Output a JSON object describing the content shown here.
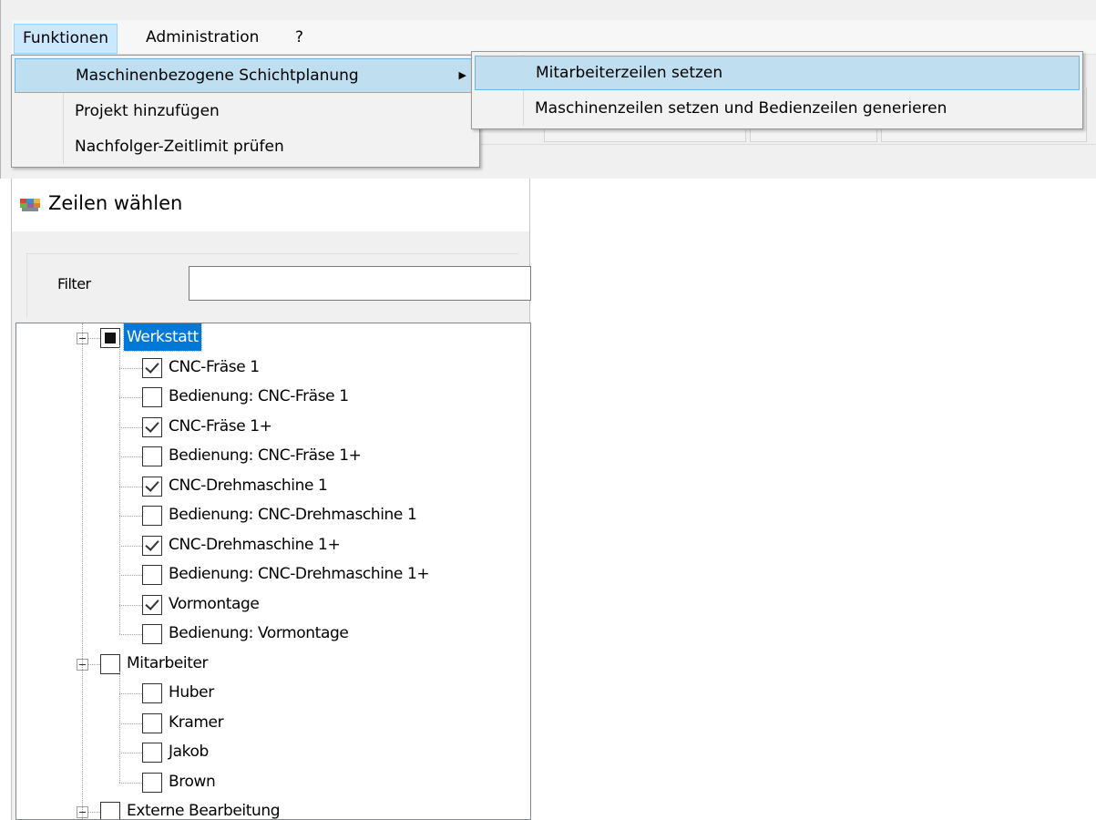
{
  "menubar": {
    "items": [
      {
        "label": "Funktionen"
      },
      {
        "label": "Administration"
      },
      {
        "label": "?"
      }
    ]
  },
  "funktionen_menu": {
    "items": [
      {
        "label": "Maschinenbezogene Schichtplanung",
        "has_submenu": true
      },
      {
        "label": "Projekt hinzufügen"
      },
      {
        "label": "Nachfolger-Zeitlimit prüfen"
      }
    ]
  },
  "schichtplanung_submenu": {
    "items": [
      {
        "label": "Mitarbeiterzeilen setzen"
      },
      {
        "label": "Maschinenzeilen setzen und Bedienzeilen generieren"
      }
    ]
  },
  "dialog": {
    "title": "Zeilen wählen",
    "filter_label": "Filter",
    "filter_value": ""
  },
  "tree": {
    "nodes": [
      {
        "label": "Werkstatt",
        "state": "indeterminate",
        "selected": true
      },
      {
        "label": "CNC-Fräse 1",
        "state": "checked"
      },
      {
        "label": "Bedienung: CNC-Fräse 1",
        "state": "unchecked"
      },
      {
        "label": "CNC-Fräse 1+",
        "state": "checked"
      },
      {
        "label": "Bedienung: CNC-Fräse 1+",
        "state": "unchecked"
      },
      {
        "label": "CNC-Drehmaschine 1",
        "state": "checked"
      },
      {
        "label": "Bedienung: CNC-Drehmaschine 1",
        "state": "unchecked"
      },
      {
        "label": "CNC-Drehmaschine 1+",
        "state": "checked"
      },
      {
        "label": "Bedienung: CNC-Drehmaschine 1+",
        "state": "unchecked"
      },
      {
        "label": "Vormontage",
        "state": "checked"
      },
      {
        "label": "Bedienung: Vormontage",
        "state": "unchecked"
      },
      {
        "label": "Mitarbeiter",
        "state": "unchecked"
      },
      {
        "label": "Huber",
        "state": "unchecked"
      },
      {
        "label": "Kramer",
        "state": "unchecked"
      },
      {
        "label": "Jakob",
        "state": "unchecked"
      },
      {
        "label": "Brown",
        "state": "unchecked"
      },
      {
        "label": "Externe Bearbeitung",
        "state": "unchecked"
      }
    ]
  },
  "colors": {
    "menu_highlight": "#bfdff1",
    "selection": "#0078d7"
  }
}
